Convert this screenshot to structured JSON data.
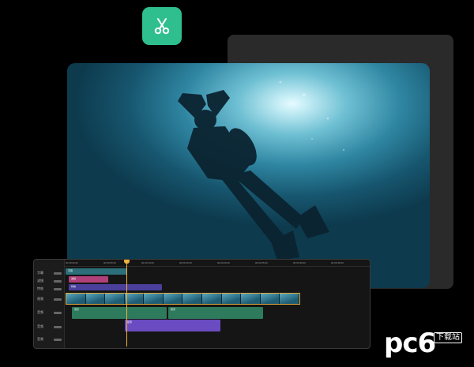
{
  "app_icon": {
    "icon": "scissors-icon",
    "color": "#2fbf8e"
  },
  "timeline": {
    "ruler_ticks": [
      "00:00:00:00",
      "00:00:05:00",
      "00:00:10:00",
      "00:00:15:00",
      "00:00:20:00",
      "00:00:25:00",
      "00:00:30:00",
      "00:00:35:00"
    ],
    "tracks": [
      {
        "label": "字幕"
      },
      {
        "label": "滤镜"
      },
      {
        "label": "特效"
      },
      {
        "label": "视频"
      },
      {
        "label": "音频"
      },
      {
        "label": "音频"
      },
      {
        "label": "音频"
      }
    ],
    "clips": {
      "subtitle": "字幕",
      "filter": "滤镜",
      "effect": "特效",
      "audio1": "音乐",
      "audio2": "音乐",
      "voice": "配音"
    },
    "playhead_color": "#f0b23c"
  },
  "watermark": {
    "brand": "pc6",
    "tag": "下载站"
  }
}
